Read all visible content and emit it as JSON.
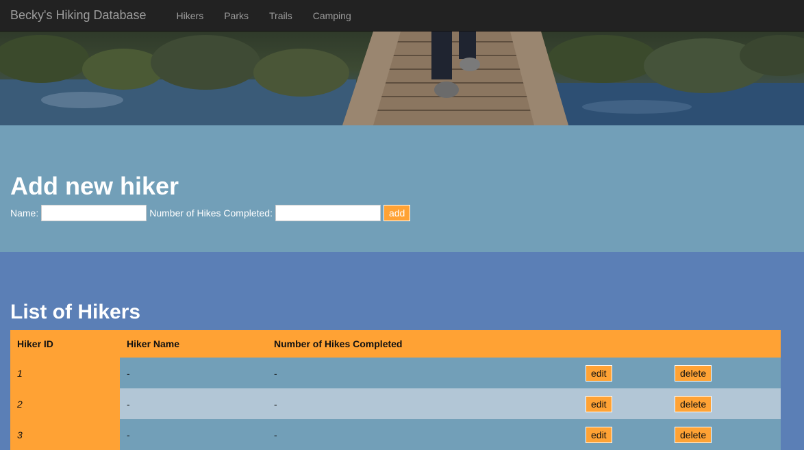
{
  "navbar": {
    "brand": "Becky's Hiking Database",
    "links": [
      "Hikers",
      "Parks",
      "Trails",
      "Camping"
    ]
  },
  "add_form": {
    "title": "Add new hiker",
    "name_label": "Name:",
    "name_value": "",
    "hikes_label": "Number of Hikes Completed:",
    "hikes_value": "",
    "add_button": "add"
  },
  "list": {
    "title": "List of Hikers",
    "headers": [
      "Hiker ID",
      "Hiker Name",
      "Number of Hikes Completed",
      "",
      ""
    ],
    "rows": [
      {
        "id": "1",
        "name": "-",
        "hikes": "-",
        "edit": "edit",
        "delete": "delete"
      },
      {
        "id": "2",
        "name": "-",
        "hikes": "-",
        "edit": "edit",
        "delete": "delete"
      },
      {
        "id": "3",
        "name": "-",
        "hikes": "-",
        "edit": "edit",
        "delete": "delete"
      }
    ]
  },
  "colors": {
    "navbar": "#222222",
    "accent": "#ffa234",
    "add_section_bg": "#729fb8",
    "list_section_bg": "#5b7fb6",
    "row_odd": "#729fb8",
    "row_even": "#b2c6d6"
  }
}
